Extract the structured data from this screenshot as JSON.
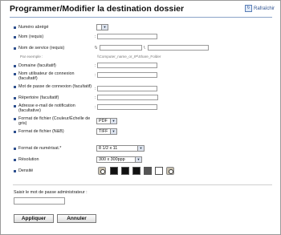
{
  "header": {
    "title": "Programmer/Modifier la destination dossier",
    "refresh_label": "Rafraîchir"
  },
  "form": {
    "numero_abrege": {
      "label": "Numéro abrégé",
      "value": ""
    },
    "nom": {
      "label": "Nom (requis)",
      "value": ""
    },
    "nom_service": {
      "label": "Nom de service (requis)",
      "prefix": "\\\\",
      "value_host": "",
      "value_path": "",
      "example_label": "Par exemple :",
      "example_value": "\\\\Computer_name_or_IP\\Share_Folder"
    },
    "domaine": {
      "label": "Domaine (facultatif)",
      "value": ""
    },
    "utilisateur": {
      "label": "Nom utilisateur de connexion (facultatif)",
      "value": ""
    },
    "mot_de_passe": {
      "label": "Mot de passe de connexion (facultatif)",
      "value": ""
    },
    "repertoire": {
      "label": "Répertoire (facultatif)",
      "value": ""
    },
    "email_notif": {
      "label": "Adresse e-mail de notification (facultative)",
      "value": ""
    },
    "format_couleur": {
      "label": "Format de fichier (Couleur/Échelle de gris)",
      "value": "PDF"
    },
    "format_nb": {
      "label": "Format de fichier (N&B)",
      "value": "TIFF"
    },
    "format_numerisation": {
      "label": "Format de numérisat.*",
      "value": "8 1/2 x 11"
    },
    "resolution": {
      "label": "Résolution",
      "value": "300 x 300ppp"
    },
    "densite": {
      "label": "Densité",
      "swatch_colors": [
        "#111111",
        "#111111",
        "#111111",
        "#555555",
        "#ffffff",
        "#ffffff"
      ]
    },
    "admin_password": {
      "label": "Saisir le mot de passe administrateur :",
      "value": ""
    }
  },
  "actions": {
    "apply_label": "Appliquer",
    "cancel_label": "Annuler"
  },
  "colors": {
    "bullet": "#2d4f8e",
    "rule": "#8aa3c8"
  }
}
